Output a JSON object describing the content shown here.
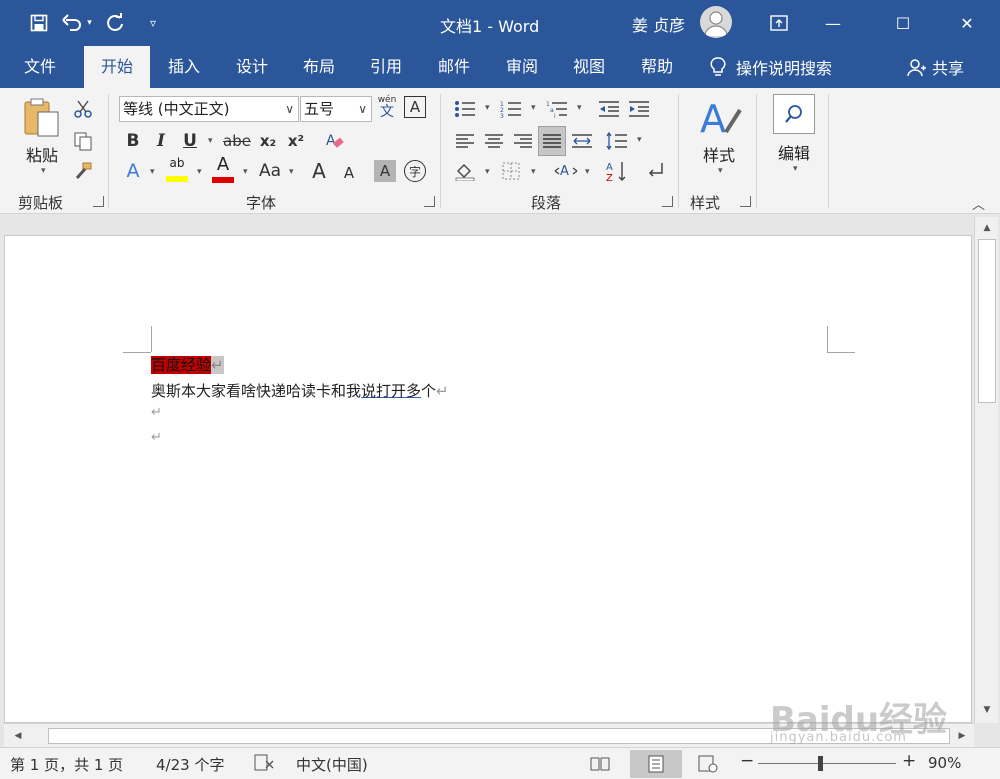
{
  "window": {
    "title": "文档1  -  Word",
    "user": "姜 贞彦",
    "minimize_glyph": "—",
    "maximize_glyph": "☐",
    "close_glyph": "✕",
    "ribbon_display_glyph": "⊡"
  },
  "qat": {
    "save_icon": "save-icon",
    "undo_icon": "undo-icon",
    "redo_icon": "redo-icon",
    "customize_icon": "customize-qat-icon"
  },
  "tabs": [
    {
      "label": "文件"
    },
    {
      "label": "开始"
    },
    {
      "label": "插入"
    },
    {
      "label": "设计"
    },
    {
      "label": "布局"
    },
    {
      "label": "引用"
    },
    {
      "label": "邮件"
    },
    {
      "label": "审阅"
    },
    {
      "label": "视图"
    },
    {
      "label": "帮助"
    }
  ],
  "active_tab": "开始",
  "tellme": {
    "label": "操作说明搜索"
  },
  "share": {
    "label": "共享"
  },
  "ribbon": {
    "clipboard": {
      "label": "剪贴板",
      "paste_label": "粘贴"
    },
    "font": {
      "label": "字体",
      "font_name": "等线 (中文正文)",
      "font_size": "五号",
      "bold": "B",
      "italic": "I",
      "underline": "U",
      "strike": "abe",
      "subscript": "x₂",
      "superscript": "x²",
      "phonetic_top": "wén",
      "phonetic_bottom": "文",
      "char_border": "A",
      "text_effects": "A",
      "highlight": "ab",
      "font_color": "A",
      "change_case": "Aa",
      "grow": "A",
      "shrink": "A",
      "char_shading": "A",
      "enclose": "字"
    },
    "paragraph": {
      "label": "段落"
    },
    "styles": {
      "label": "样式",
      "button_label": "样式"
    },
    "editing": {
      "button_label": "编辑"
    },
    "colors": {
      "highlight": "#ffff00",
      "font_color": "#e00000"
    }
  },
  "document": {
    "line1": "百度经验",
    "line2_plain": "奥斯本大家看啥快递哈读卡和我",
    "line2_marked": "说打开多",
    "line2_tail": "个",
    "para_mark": "↵",
    "highlight_color": "#c00000"
  },
  "status": {
    "page": "第 1 页，共 1 页",
    "words": "4/23 个字",
    "language": "中文(中国)",
    "zoom_minus": "−",
    "zoom_plus": "+",
    "zoom": "90%"
  },
  "watermark": {
    "text": "Baidu经验",
    "sub": "jingyan.baidu.com"
  }
}
